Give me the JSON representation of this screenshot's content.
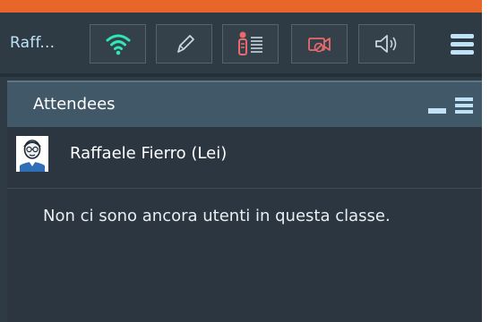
{
  "toolbar": {
    "user_label": "Raff...",
    "buttons": [
      {
        "icon": "wifi-icon",
        "color": "#2ee6b8"
      },
      {
        "icon": "pencil-icon",
        "color": "#c8d6df"
      },
      {
        "icon": "raise-hand-list-icon",
        "color": "#e86a6a"
      },
      {
        "icon": "camera-off-icon",
        "color": "#e86a6a"
      },
      {
        "icon": "speaker-icon",
        "color": "#c8d6df"
      }
    ],
    "menu_icon": "hamburger-icon"
  },
  "panel": {
    "title": "Attendees",
    "attendee": {
      "name": "Raffaele Fierro (Lei)",
      "avatar_icon": "user-avatar-icon"
    },
    "empty_message": "Non ci sono ancora utenti in questa classe."
  },
  "colors": {
    "accent_orange": "#e8662a",
    "icon_blue": "#bfe2f7",
    "background": "#2e3a44"
  }
}
